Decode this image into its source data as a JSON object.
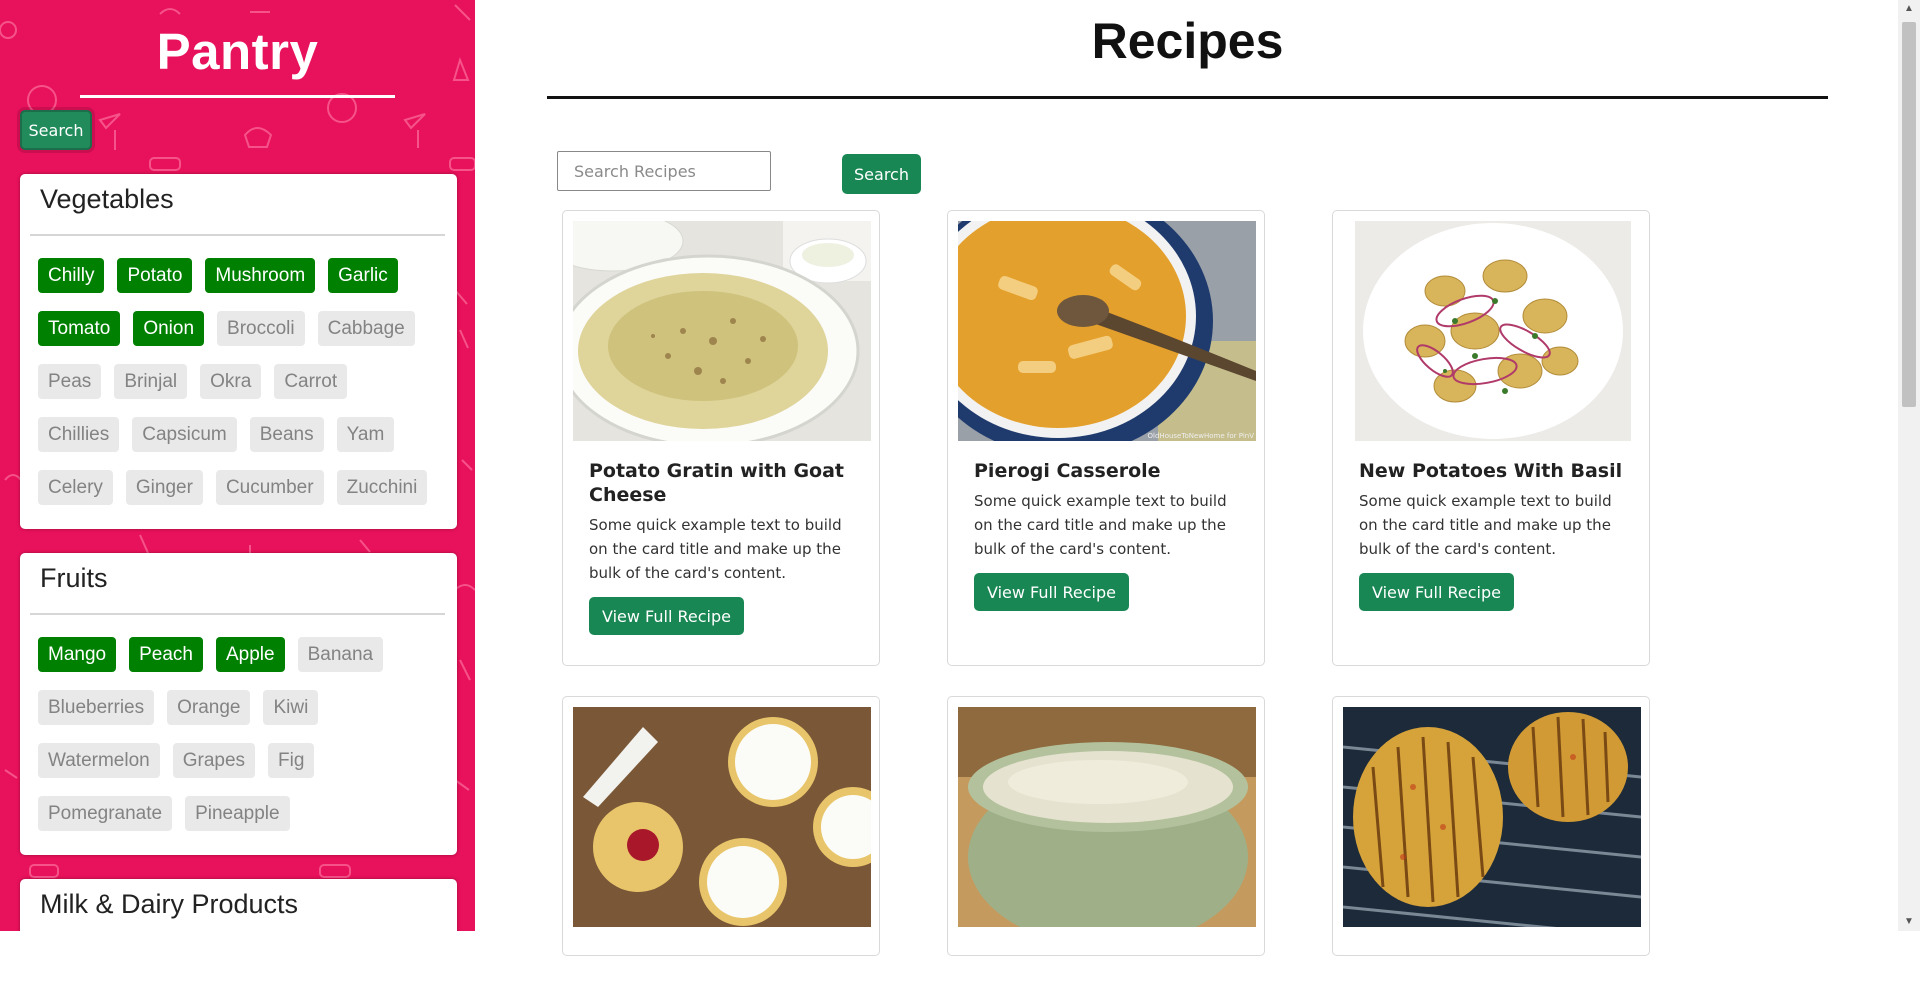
{
  "sidebar": {
    "brand": "Pantry",
    "search_label": "Search",
    "background": "#e8115b",
    "sections": [
      {
        "title": "Vegetables",
        "items": [
          {
            "label": "Chilly",
            "selected": true
          },
          {
            "label": "Potato",
            "selected": true
          },
          {
            "label": "Mushroom",
            "selected": true
          },
          {
            "label": "Garlic",
            "selected": true
          },
          {
            "label": "Tomato",
            "selected": true
          },
          {
            "label": "Onion",
            "selected": true
          },
          {
            "label": "Broccoli",
            "selected": false
          },
          {
            "label": "Cabbage",
            "selected": false
          },
          {
            "label": "Peas",
            "selected": false
          },
          {
            "label": "Brinjal",
            "selected": false
          },
          {
            "label": "Okra",
            "selected": false
          },
          {
            "label": "Carrot",
            "selected": false
          },
          {
            "label": "Chillies",
            "selected": false
          },
          {
            "label": "Capsicum",
            "selected": false
          },
          {
            "label": "Beans",
            "selected": false
          },
          {
            "label": "Yam",
            "selected": false
          },
          {
            "label": "Celery",
            "selected": false
          },
          {
            "label": "Ginger",
            "selected": false
          },
          {
            "label": "Cucumber",
            "selected": false
          },
          {
            "label": "Zucchini",
            "selected": false
          }
        ]
      },
      {
        "title": "Fruits",
        "items": [
          {
            "label": "Mango",
            "selected": true
          },
          {
            "label": "Peach",
            "selected": true
          },
          {
            "label": "Apple",
            "selected": true
          },
          {
            "label": "Banana",
            "selected": false
          },
          {
            "label": "Blueberries",
            "selected": false
          },
          {
            "label": "Orange",
            "selected": false
          },
          {
            "label": "Kiwi",
            "selected": false
          },
          {
            "label": "Watermelon",
            "selected": false
          },
          {
            "label": "Grapes",
            "selected": false
          },
          {
            "label": "Fig",
            "selected": false
          },
          {
            "label": "Pomegranate",
            "selected": false
          },
          {
            "label": "Pineapple",
            "selected": false
          }
        ]
      },
      {
        "title": "Milk & Dairy Products",
        "items": []
      }
    ]
  },
  "main": {
    "title": "Recipes",
    "search": {
      "placeholder": "Search Recipes",
      "value": "",
      "button_label": "Search"
    },
    "recipes": [
      {
        "title": "Potato Gratin with Goat Cheese",
        "text": "Some quick example text to build on the card title and make up the bulk of the card's content.",
        "button": "View Full Recipe",
        "image": "potato-gratin-photo"
      },
      {
        "title": "Pierogi Casserole",
        "text": "Some quick example text to build on the card title and make up the bulk of the card's content.",
        "button": "View Full Recipe",
        "image": "pierogi-casserole-photo",
        "image_caption": "OldHouseToNewHome for PinV"
      },
      {
        "title": "New Potatoes With Basil",
        "text": "Some quick example text to build on the card title and make up the bulk of the card's content.",
        "button": "View Full Recipe",
        "image": "potato-salad-photo"
      },
      {
        "image": "cupcakes-photo"
      },
      {
        "image": "dip-bowl-photo"
      },
      {
        "image": "hasselback-potato-photo"
      }
    ]
  },
  "colors": {
    "accent_green": "#198754",
    "chip_selected": "#008000",
    "chip_unselected": "#e9e9e9"
  }
}
